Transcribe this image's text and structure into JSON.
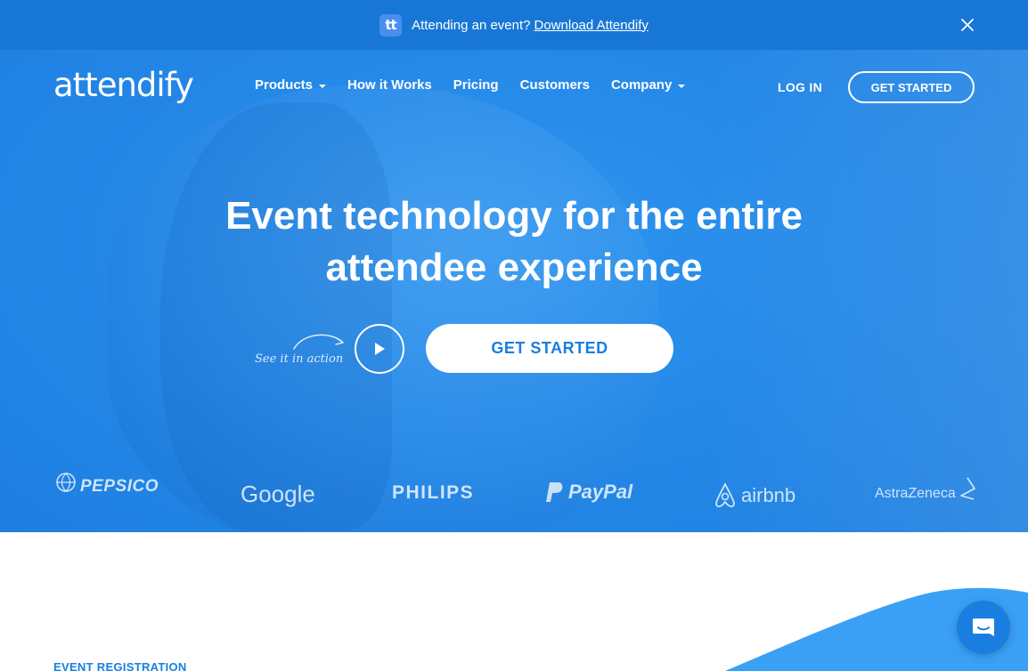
{
  "announcement": {
    "app_icon": "tt-app-icon",
    "app_icon_text": "tt",
    "message": "Attending an event?",
    "link_label": "Download Attendify",
    "close_icon": "close-icon"
  },
  "nav": {
    "logo_text": "attendify",
    "items": [
      {
        "label": "Products",
        "has_dropdown": true
      },
      {
        "label": "How it Works",
        "has_dropdown": false
      },
      {
        "label": "Pricing",
        "has_dropdown": false
      },
      {
        "label": "Customers",
        "has_dropdown": false
      },
      {
        "label": "Company",
        "has_dropdown": true
      }
    ],
    "login_label": "LOG IN",
    "cta_label": "GET STARTED"
  },
  "hero": {
    "headline_line1": "Event technology for the entire",
    "headline_line2": "attendee experience",
    "see_it_label": "See it in action",
    "play_icon": "play-icon",
    "cta_label": "GET STARTED",
    "background_color": "#2589e8"
  },
  "brands": {
    "pepsico": "PEPSICO",
    "google": "Google",
    "philips": "PHILIPS",
    "paypal": "PayPal",
    "airbnb": "airbnb",
    "astrazeneca": "AstraZeneca"
  },
  "section": {
    "label": "EVENT REGISTRATION"
  },
  "chat": {
    "icon": "chat-icon"
  },
  "colors": {
    "topbar": "#1877d6",
    "accent": "#1a7ee0",
    "wave": "#3aa0f5"
  }
}
